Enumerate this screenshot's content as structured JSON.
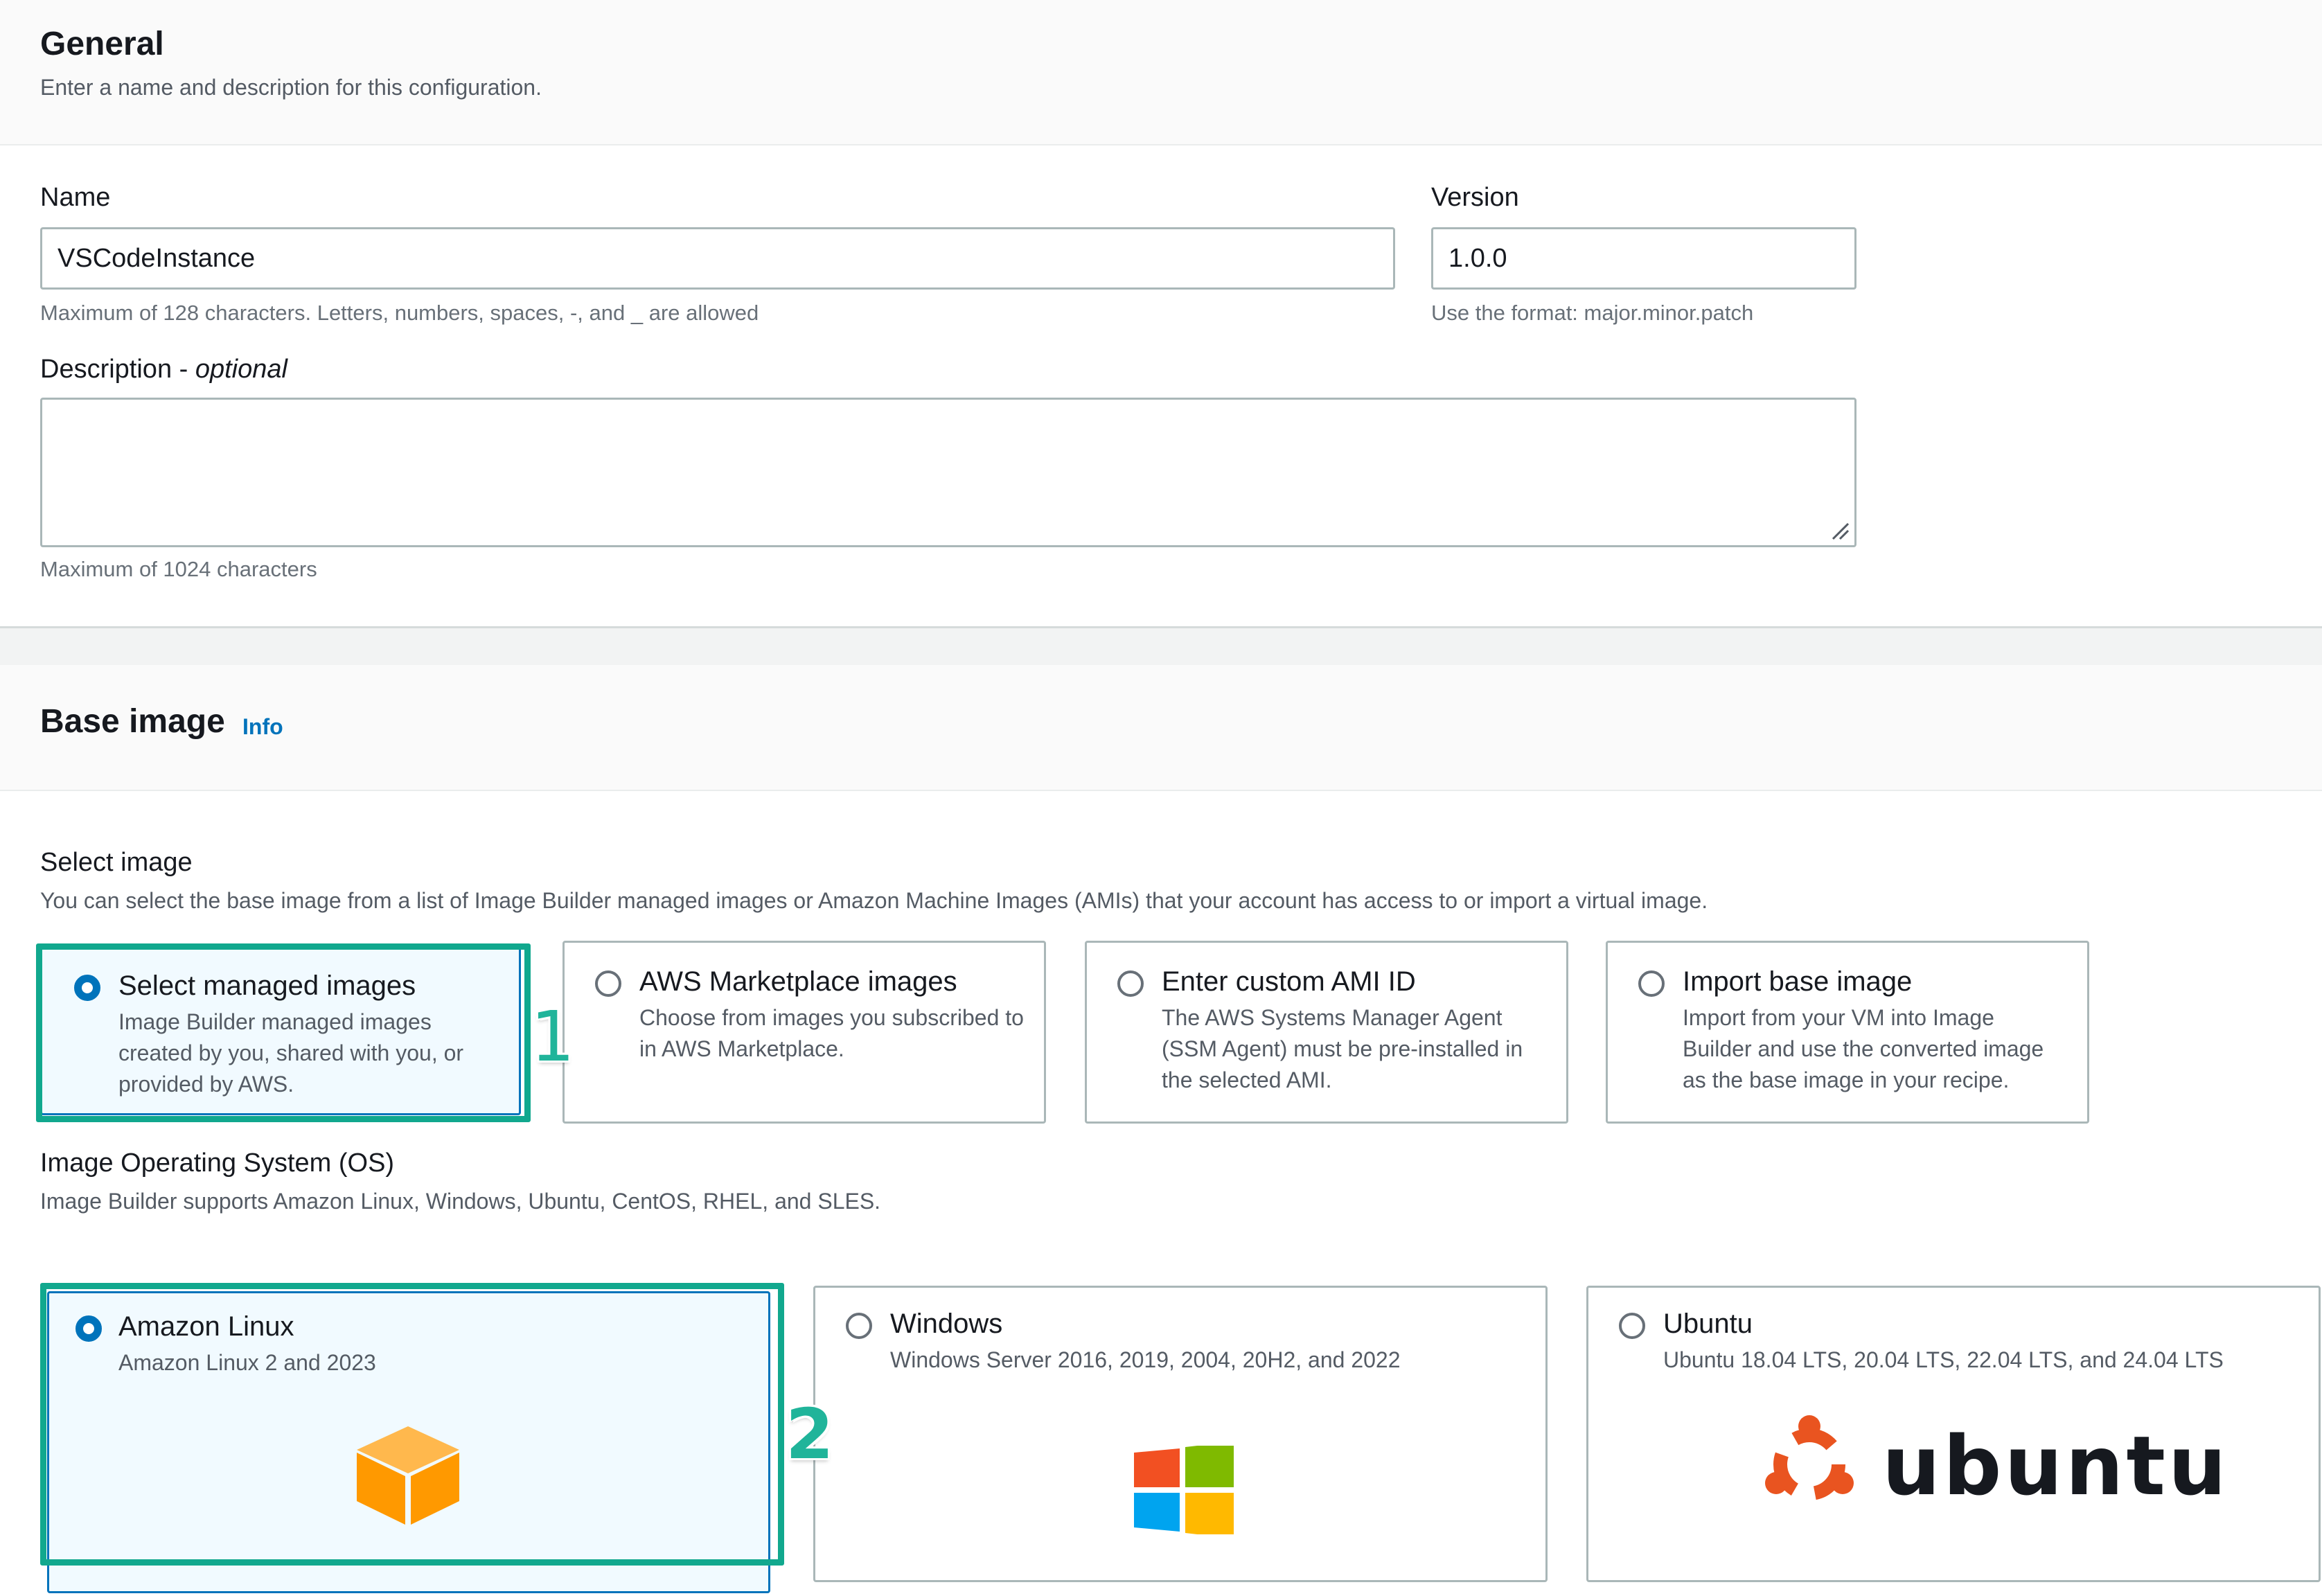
{
  "general": {
    "title": "General",
    "description": "Enter a name and description for this configuration.",
    "name_label": "Name",
    "name_value": "VSCodeInstance",
    "name_hint": "Maximum of 128 characters. Letters, numbers, spaces, -, and _ are allowed",
    "version_label": "Version",
    "version_value": "1.0.0",
    "version_hint": "Use the format: major.minor.patch",
    "description_label": "Description - ",
    "description_label_optional": "optional",
    "description_value": "",
    "description_hint": "Maximum of 1024 characters"
  },
  "base_image": {
    "title": "Base image",
    "info": "Info",
    "select_image_label": "Select image",
    "select_image_desc": "You can select the base image from a list of Image Builder managed images or Amazon Machine Images (AMIs) that your account has access to or import a virtual image.",
    "options": [
      {
        "title": "Select managed images",
        "desc": "Image Builder managed images created by you, shared with you, or provided by AWS.",
        "selected": true
      },
      {
        "title": "AWS Marketplace images",
        "desc": "Choose from images you subscribed to in AWS Marketplace.",
        "selected": false
      },
      {
        "title": "Enter custom AMI ID",
        "desc": "The AWS Systems Manager Agent (SSM Agent) must be pre-installed in the selected AMI.",
        "selected": false
      },
      {
        "title": "Import base image",
        "desc": "Import from your VM into Image Builder and use the converted image as the base image in your recipe.",
        "selected": false
      }
    ],
    "os_label": "Image Operating System (OS)",
    "os_desc": "Image Builder supports Amazon Linux, Windows, Ubuntu, CentOS, RHEL, and SLES.",
    "os_options": [
      {
        "title": "Amazon Linux",
        "desc": "Amazon Linux 2 and 2023",
        "selected": true,
        "icon": "amazon-linux-cube-icon"
      },
      {
        "title": "Windows",
        "desc": "Windows Server 2016, 2019, 2004, 20H2, and 2022",
        "selected": false,
        "icon": "windows-logo-icon"
      },
      {
        "title": "Ubuntu",
        "desc": "Ubuntu 18.04 LTS, 20.04 LTS, 22.04 LTS, and 24.04 LTS",
        "selected": false,
        "icon": "ubuntu-logo-icon",
        "logo_text": "ubuntu"
      }
    ]
  },
  "annotations": {
    "marker_1": "1",
    "marker_2": "2",
    "highlight_color": "#11a88e"
  },
  "colors": {
    "accent": "#0073bb",
    "amazon_orange": "#ff9900",
    "ubuntu_orange": "#e95420"
  }
}
